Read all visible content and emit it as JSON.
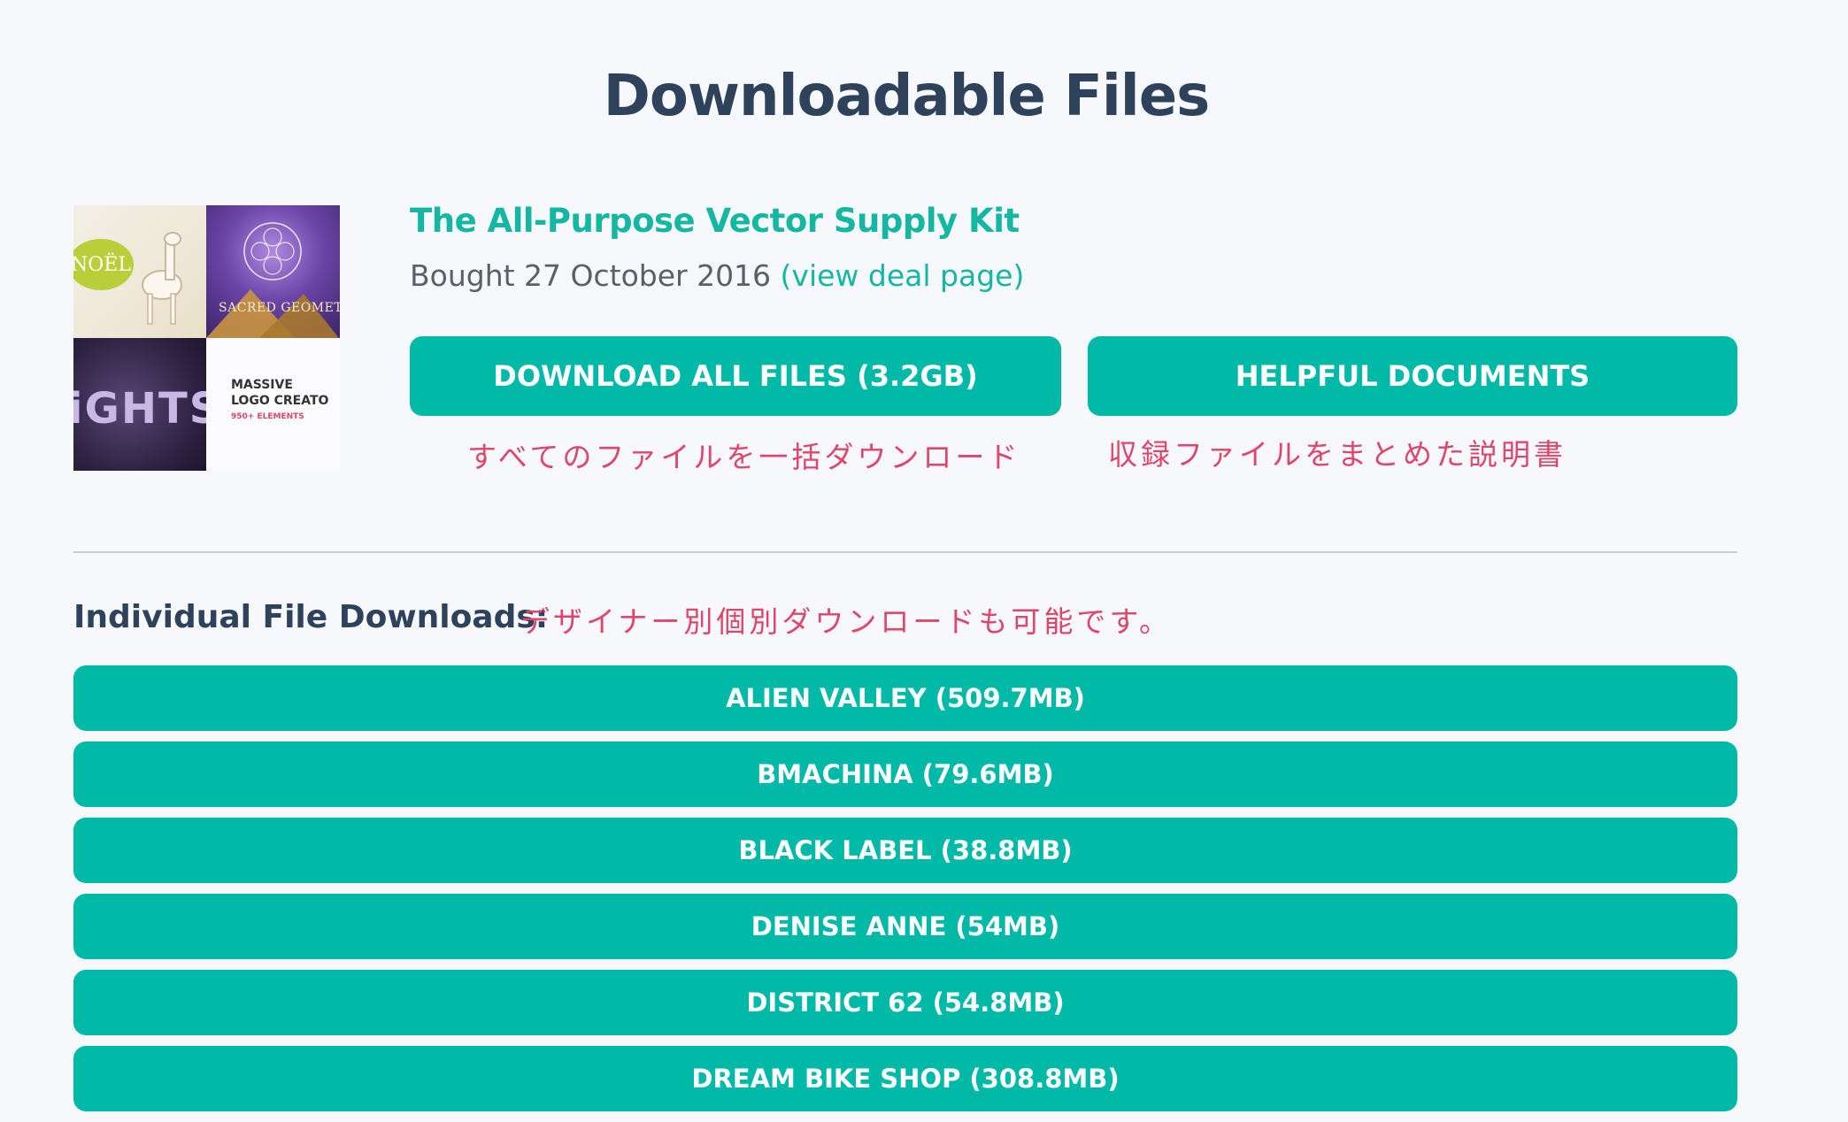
{
  "page": {
    "title": "Downloadable Files"
  },
  "deal": {
    "title": "The All-Purpose Vector Supply Kit",
    "bought_prefix": "Bought 27 October 2016 ",
    "view_link": "(view deal page)",
    "thumbnail": {
      "tile1_text": "NOËL",
      "tile2_text": "SACRED GEOMET",
      "tile3_text": "iGHTS",
      "tile4_text_line1": "MASSIVE",
      "tile4_text_line2": "LOGO CREATO",
      "tile4_text_line3": "950+ ELEMENTS"
    }
  },
  "actions": {
    "download_all": "DOWNLOAD ALL FILES (3.2GB)",
    "helpful_docs": "HELPFUL DOCUMENTS",
    "download_all_note": "すべてのファイルを一括ダウンロード",
    "helpful_docs_note": "収録ファイルをまとめた説明書"
  },
  "individual": {
    "heading": "Individual File Downloads:",
    "note": "デザイナー別個別ダウンロードも可能です。",
    "files": [
      "ALIEN VALLEY (509.7MB)",
      "BMACHINA (79.6MB)",
      "BLACK LABEL (38.8MB)",
      "DENISE ANNE (54MB)",
      "DISTRICT 62 (54.8MB)",
      "DREAM BIKE SHOP (308.8MB)"
    ]
  },
  "colors": {
    "accent": "#00b9a7",
    "title_dark": "#2e425c",
    "annotation_red": "#e0456a",
    "background": "#f6f8fc"
  }
}
